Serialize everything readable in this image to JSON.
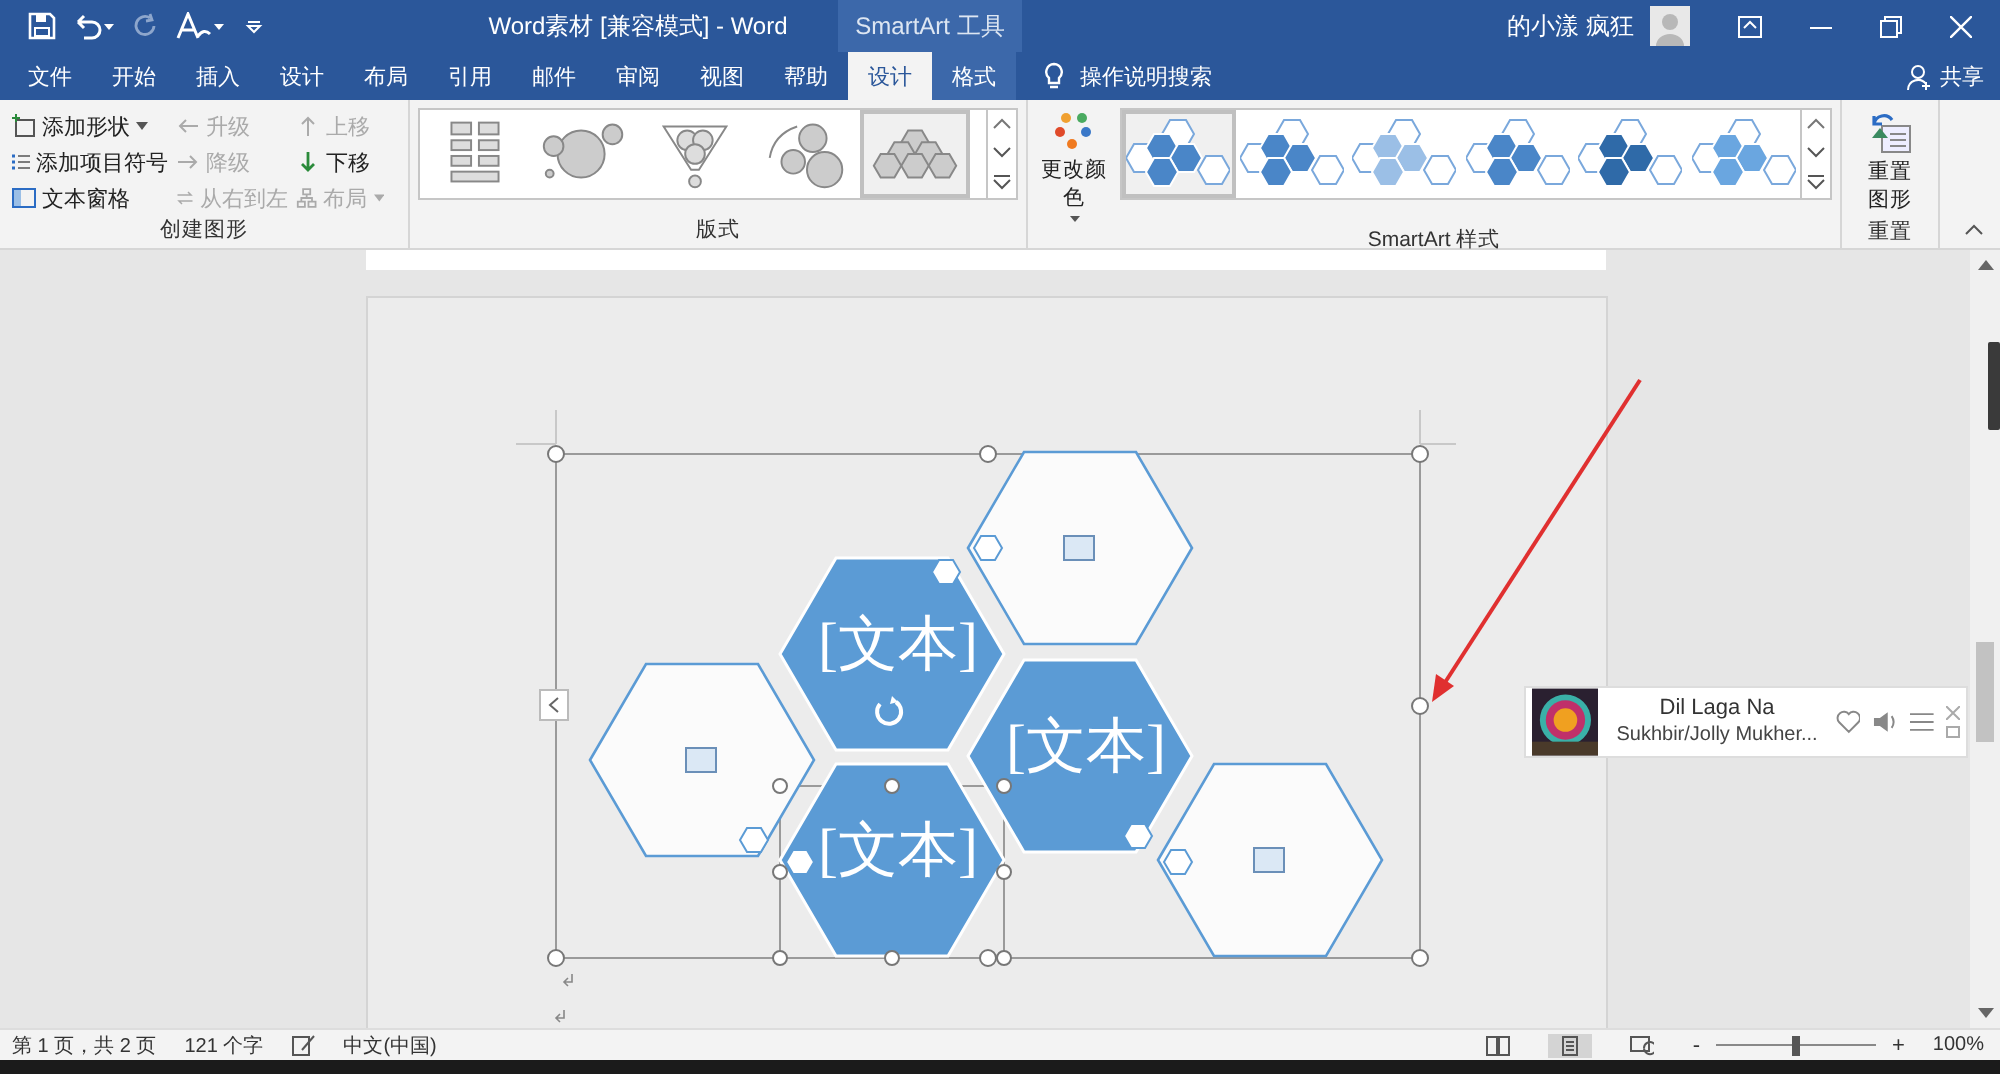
{
  "title_bar": {
    "title": "Word素材 [兼容模式]  -  Word",
    "context_label": "SmartArt 工具",
    "user": "的小漾 疯狂"
  },
  "tabs": [
    {
      "label": "文件",
      "kind": "main",
      "selected": false
    },
    {
      "label": "开始",
      "kind": "main",
      "selected": false
    },
    {
      "label": "插入",
      "kind": "main",
      "selected": false
    },
    {
      "label": "设计",
      "kind": "main",
      "selected": false
    },
    {
      "label": "布局",
      "kind": "main",
      "selected": false
    },
    {
      "label": "引用",
      "kind": "main",
      "selected": false
    },
    {
      "label": "邮件",
      "kind": "main",
      "selected": false
    },
    {
      "label": "审阅",
      "kind": "main",
      "selected": false
    },
    {
      "label": "视图",
      "kind": "main",
      "selected": false
    },
    {
      "label": "帮助",
      "kind": "main",
      "selected": false
    },
    {
      "label": "设计",
      "kind": "context",
      "selected": true
    },
    {
      "label": "格式",
      "kind": "context",
      "selected": false
    }
  ],
  "tell_me": "操作说明搜索",
  "share": "共享",
  "create_graphic": {
    "label": "创建图形",
    "commands": [
      {
        "label": "添加形状",
        "disabled": false,
        "dropdown": true
      },
      {
        "label": "添加项目符号",
        "disabled": false,
        "dropdown": false
      },
      {
        "label": "文本窗格",
        "disabled": false,
        "dropdown": false
      },
      {
        "label": "升级",
        "disabled": true,
        "dropdown": false
      },
      {
        "label": "降级",
        "disabled": true,
        "dropdown": false
      },
      {
        "label": "从右到左",
        "disabled": true,
        "dropdown": false
      },
      {
        "label": "上移",
        "disabled": true,
        "dropdown": false
      },
      {
        "label": "下移",
        "disabled": false,
        "dropdown": false
      },
      {
        "label": "布局",
        "disabled": true,
        "dropdown": true
      }
    ]
  },
  "layout_group": {
    "label": "版式",
    "layouts": [
      {
        "kind": "list",
        "selected": false
      },
      {
        "kind": "cycle",
        "selected": false
      },
      {
        "kind": "funnel",
        "selected": false
      },
      {
        "kind": "gears",
        "selected": false
      },
      {
        "kind": "hexagons",
        "selected": true
      }
    ]
  },
  "style_group": {
    "label": "SmartArt 样式",
    "change_colors": "更改颜色",
    "styles": [
      {
        "kind": "flat",
        "selected": true
      },
      {
        "kind": "flat",
        "selected": false
      },
      {
        "kind": "light",
        "selected": false
      },
      {
        "kind": "flat",
        "selected": false
      },
      {
        "kind": "dark",
        "selected": false
      },
      {
        "kind": "glossy",
        "selected": false
      }
    ]
  },
  "reset_group": {
    "label": "重置",
    "button": "重置图形"
  },
  "smartart": {
    "shapes": [
      {
        "kind": "picture_slot"
      },
      {
        "kind": "text",
        "text": "[文本]"
      },
      {
        "kind": "picture_slot"
      },
      {
        "kind": "text",
        "text": "[文本]"
      },
      {
        "kind": "text",
        "text": "[文本]"
      },
      {
        "kind": "picture_slot"
      }
    ]
  },
  "music_player": {
    "title": "Dil Laga Na",
    "artist": "Sukhbir/Jolly Mukher..."
  },
  "status_bar": {
    "page": "第 1 页，共 2 页",
    "words": "121 个字",
    "language": "中文(中国)",
    "views": [
      {
        "selected": false
      },
      {
        "selected": true
      },
      {
        "selected": false
      }
    ],
    "zoom_out": "-",
    "zoom_in": "+",
    "zoom": {
      "level": 0.5
    },
    "zoom_percent": "100%"
  }
}
